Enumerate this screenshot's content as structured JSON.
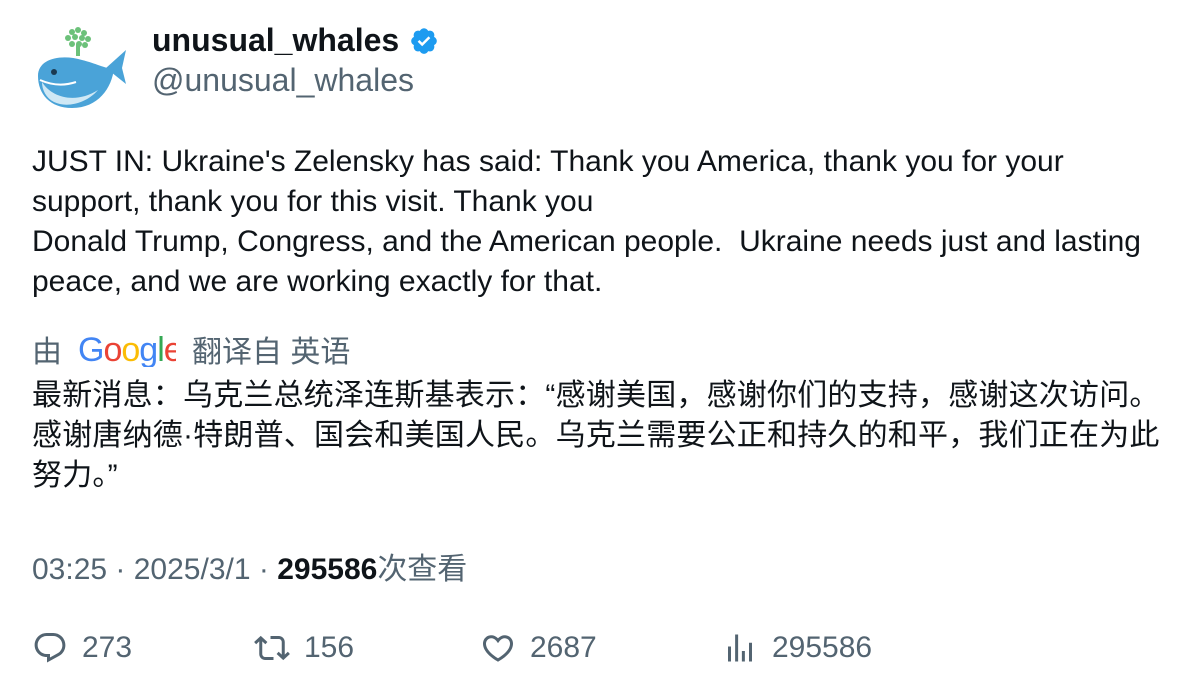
{
  "author": {
    "name": "unusual_whales",
    "handle": "@unusual_whales",
    "verified": true,
    "avatar_icon": "whale-icon"
  },
  "tweet": {
    "lines": [
      "JUST IN: Ukraine's Zelensky has said: Thank you America, thank you for your support, thank you for this visit. Thank you",
      "Donald Trump, Congress, and the American people.  Ukraine needs just and lasting peace, and we are working exactly for that."
    ]
  },
  "translation": {
    "by_label": "由",
    "provider": "Google",
    "from_label": "翻译自 英语",
    "text": "最新消息：乌克兰总统泽连斯基表示：“感谢美国，感谢你们的支持，感谢这次访问。感谢唐纳德·特朗普、国会和美国人民。乌克兰需要公正和持久的和平，我们正在为此努力。”"
  },
  "meta": {
    "time": "03:25",
    "sep": " · ",
    "date": "2025/3/1",
    "views_count": "295586",
    "views_label": "次查看"
  },
  "actions": {
    "replies": "273",
    "retweets": "156",
    "likes": "2687",
    "views": "295586"
  },
  "colors": {
    "verified": "#1d9bf0",
    "secondary_text": "#536471",
    "google_blue": "#4285F4",
    "google_red": "#EA4335",
    "google_yellow": "#FBBC05",
    "google_green": "#34A853"
  }
}
